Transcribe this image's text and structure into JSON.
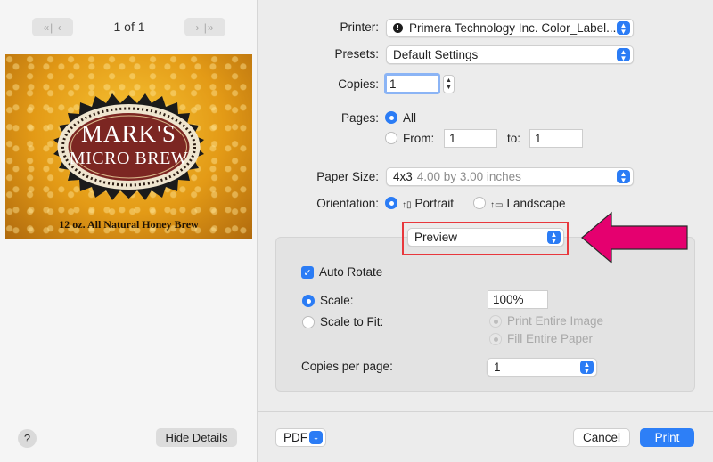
{
  "preview_pane": {
    "prev_page_glyph": "«| ‹",
    "next_page_glyph": "› |»",
    "page_indicator": "1 of 1",
    "label_line1": "MARK'S",
    "label_line2": "MICRO BREW",
    "label_tagline": "12 oz. All Natural Honey Brew",
    "help_label": "?",
    "hide_details_label": "Hide Details"
  },
  "printer": {
    "label": "Printer:",
    "value": "Primera Technology Inc. Color_Label..."
  },
  "presets": {
    "label": "Presets:",
    "value": "Default Settings"
  },
  "copies": {
    "label": "Copies:",
    "value": "1"
  },
  "pages": {
    "label": "Pages:",
    "all_label": "All",
    "from_label": "From:",
    "from_value": "1",
    "to_label": "to:",
    "to_value": "1",
    "selected": "All"
  },
  "paper_size": {
    "label": "Paper Size:",
    "value": "4x3",
    "dimensions": "4.00 by 3.00 inches"
  },
  "orientation": {
    "label": "Orientation:",
    "portrait_label": "Portrait",
    "landscape_label": "Landscape",
    "selected": "Portrait"
  },
  "section_menu": {
    "value": "Preview"
  },
  "preview_options": {
    "auto_rotate_label": "Auto Rotate",
    "auto_rotate_checked": true,
    "scale_label": "Scale:",
    "scale_value": "100%",
    "scale_to_fit_label": "Scale to Fit:",
    "print_entire_image_label": "Print Entire Image",
    "fill_entire_paper_label": "Fill Entire Paper",
    "copies_per_page_label": "Copies per page:",
    "copies_per_page_value": "1"
  },
  "footer": {
    "pdf_label": "PDF",
    "cancel_label": "Cancel",
    "print_label": "Print"
  },
  "colors": {
    "accent": "#2b7cf5",
    "highlight_box": "#e8383d",
    "annotation_arrow": "#e5006f"
  }
}
